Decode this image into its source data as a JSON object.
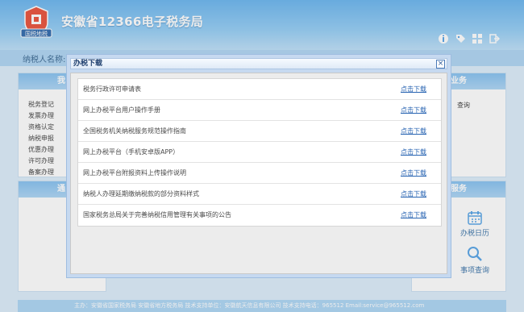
{
  "header": {
    "logo_text": "国税地税",
    "title": "安徽省12366电子税务局",
    "icons": [
      "info-icon",
      "tag-icon",
      "grid-icon",
      "exit-icon"
    ]
  },
  "strip": {
    "label": "纳税人名称:"
  },
  "left_panel": {
    "heading": "我",
    "items": [
      "税务登记",
      "发票办理",
      "资格认定",
      "纳税申报",
      "优惠办理",
      "许可办理",
      "备案办理"
    ]
  },
  "left_panel2": {
    "heading": "通"
  },
  "right_panel": {
    "heading": "业务",
    "item": "查询"
  },
  "right_panel2": {
    "heading": "服务",
    "services": [
      {
        "label": "办税日历",
        "icon": "calendar-icon"
      },
      {
        "label": "事项查询",
        "icon": "search-icon"
      }
    ]
  },
  "footer": {
    "text": "主办：安徽省国家税务局 安徽省地方税务局   技术支持单位：安徽航天信息有限公司 技术支持电话：965512 Email:service@965512.com"
  },
  "dialog": {
    "title": "办税下载",
    "link_label": "点击下载",
    "files": [
      "税务行政许可申请表",
      "网上办税平台用户操作手册",
      "全国税务机关纳税服务规范操作指南",
      "网上办税平台（手机安卓版APP）",
      "网上办税平台附报资料上传操作说明",
      "纳税人办理延期缴纳税款的部分资料样式",
      "国家税务总局关于完善纳税信用管理有关事项的公告"
    ]
  },
  "colors": {
    "header": "#6ab6ef",
    "link": "#2b66b3",
    "dialog_border": "#9fbde0"
  }
}
